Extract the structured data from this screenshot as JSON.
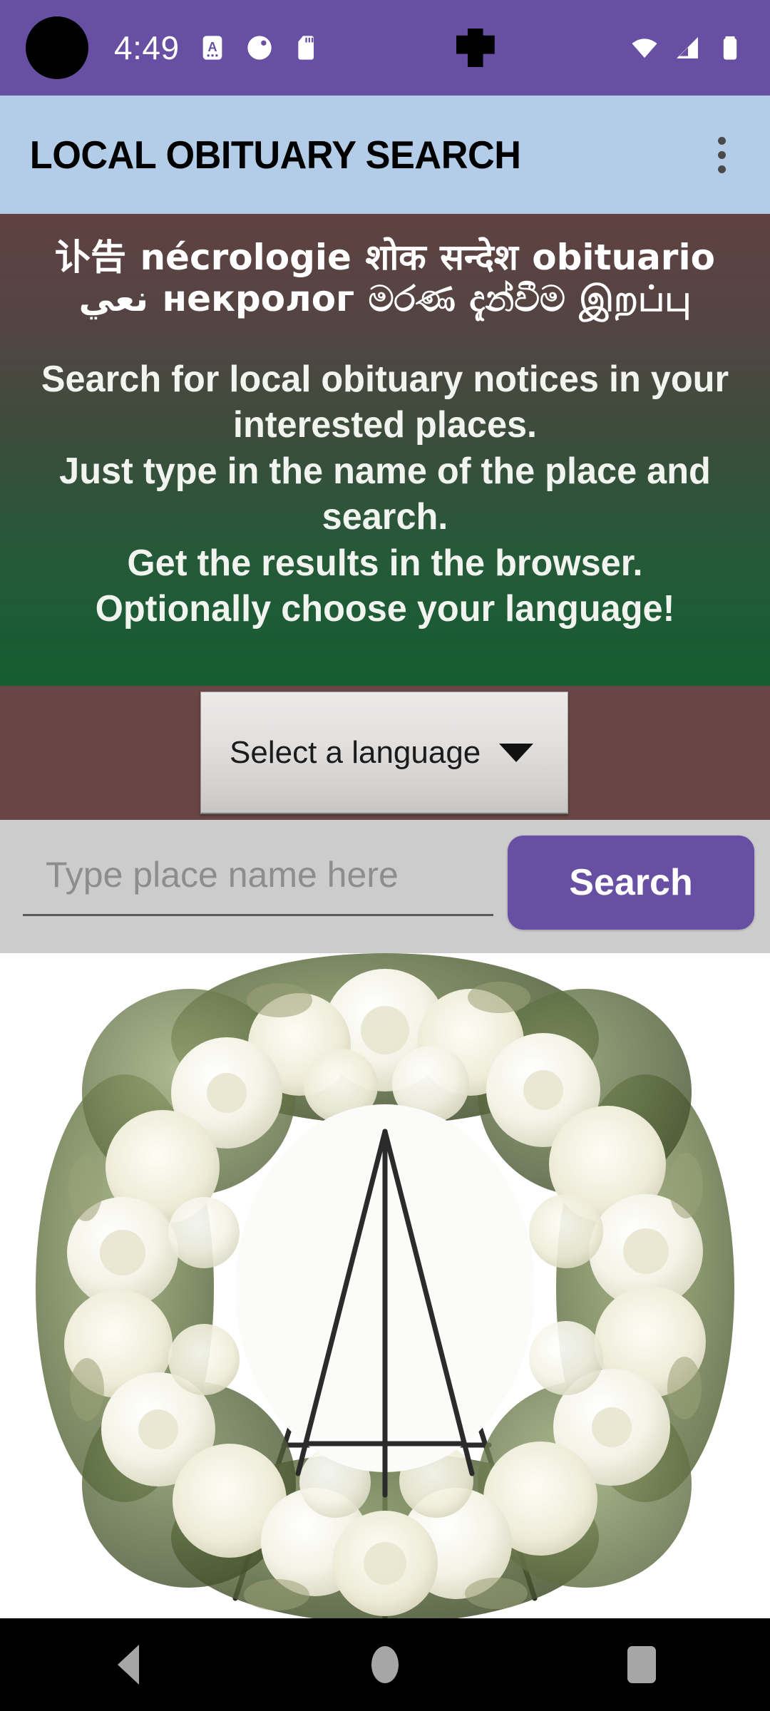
{
  "status_bar": {
    "time": "4:49",
    "background_color": "#6750A4",
    "left_icons": [
      "camera-punch-hole"
    ],
    "tray_icons": [
      "keyboard-language-icon",
      "contrast-theme-icon",
      "sd-card-icon"
    ],
    "center_icon": "redacted-notification-icon",
    "right_icons": [
      "wifi-icon",
      "cellular-signal-icon",
      "battery-icon"
    ]
  },
  "app_bar": {
    "title": "LOCAL OBITUARY SEARCH",
    "background_color": "#B3CDE8",
    "overflow_icon": "more-vertical-icon"
  },
  "hero": {
    "multilingual_title": "讣告 nécrologie शोक सन्देश obituario نعي некролог මරණ දැන්වීම இறப்பு",
    "description_lines": [
      "Search for local obituary notices in your interested places.",
      "Just type in the name of the place and search.",
      "Get the results in the browser.",
      "Optionally choose your language!"
    ],
    "gradient_top_color": "#5F4242",
    "gradient_bottom_color": "#155C32"
  },
  "language_selector": {
    "selected_value": "Select a language",
    "caret_icon": "chevron-down-icon",
    "band_background_color": "#694545"
  },
  "search": {
    "input_value": "",
    "input_placeholder": "Type place name here",
    "button_label": "Search",
    "button_color": "#6750A4",
    "band_background_color": "#CCCCCC"
  },
  "photo": {
    "alt": "white funeral flower wreath on black tripod easel stand",
    "background_color": "#FFFFFF"
  },
  "nav_bar": {
    "background_color": "#000000",
    "buttons": [
      {
        "name": "back",
        "icon": "triangle-back-icon"
      },
      {
        "name": "home",
        "icon": "circle-home-icon"
      },
      {
        "name": "recents",
        "icon": "square-recents-icon"
      }
    ]
  }
}
